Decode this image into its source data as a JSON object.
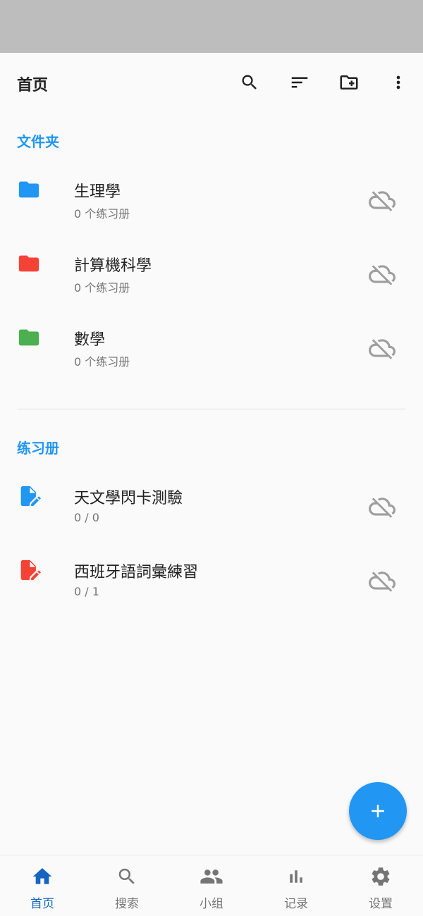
{
  "app_bar": {
    "title": "首页",
    "actions": [
      "search-icon",
      "sort-icon",
      "create-folder-icon",
      "more-vert-icon"
    ]
  },
  "folders": {
    "header": "文件夹",
    "items": [
      {
        "name": "生理學",
        "count": "0 个练习册",
        "color": "#2196f3",
        "icon": "folder-icon"
      },
      {
        "name": "計算機科學",
        "count": "0 个练习册",
        "color": "#f44336",
        "icon": "folder-icon"
      },
      {
        "name": "數學",
        "count": "0 个练习册",
        "color": "#4caf50",
        "icon": "folder-icon"
      }
    ]
  },
  "workbooks": {
    "header": "练习册",
    "items": [
      {
        "name": "天文學閃卡測驗",
        "progress": "0 / 0",
        "color": "#2196f3",
        "icon": "edit-document-icon"
      },
      {
        "name": "西班牙語詞彙練習",
        "progress": "0 / 1",
        "color": "#f44336",
        "icon": "edit-document-icon"
      }
    ]
  },
  "sync_icon": "cloud-off-icon",
  "fab": {
    "icon": "plus-icon",
    "color": "#2196f3"
  },
  "bottom_nav": {
    "items": [
      {
        "label": "首页",
        "icon": "home-icon",
        "active": true
      },
      {
        "label": "搜索",
        "icon": "search-icon",
        "active": false
      },
      {
        "label": "小组",
        "icon": "group-icon",
        "active": false
      },
      {
        "label": "记录",
        "icon": "bar-chart-icon",
        "active": false
      },
      {
        "label": "设置",
        "icon": "gear-icon",
        "active": false
      }
    ]
  },
  "colors": {
    "accent": "#2196f3",
    "nav_active": "#1565c0",
    "nav_inactive": "#757575",
    "cloud_icon": "#9e9e9e"
  }
}
